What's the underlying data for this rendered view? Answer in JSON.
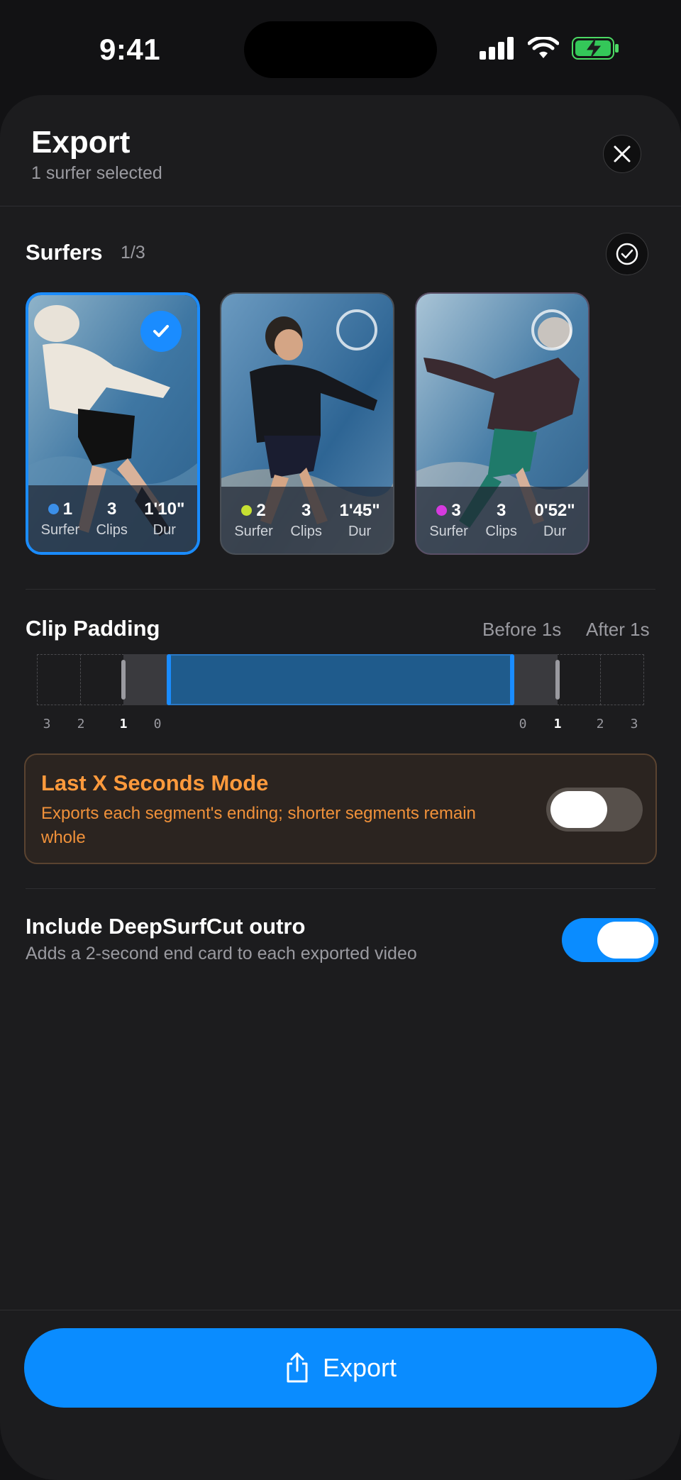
{
  "status_bar": {
    "time": "9:41"
  },
  "header": {
    "title": "Export",
    "subtitle": "1 surfer selected"
  },
  "surfers": {
    "title": "Surfers",
    "count": "1/3",
    "cards": [
      {
        "number": "1",
        "number_label": "Surfer",
        "clips": "3",
        "clips_label": "Clips",
        "duration": "1'10\"",
        "duration_label": "Dur",
        "dot_color": "#3b8fe8",
        "selected": true
      },
      {
        "number": "2",
        "number_label": "Surfer",
        "clips": "3",
        "clips_label": "Clips",
        "duration": "1'45\"",
        "duration_label": "Dur",
        "dot_color": "#c6e032",
        "selected": false
      },
      {
        "number": "3",
        "number_label": "Surfer",
        "clips": "3",
        "clips_label": "Clips",
        "duration": "0'52\"",
        "duration_label": "Dur",
        "dot_color": "#d63adf",
        "selected": false
      }
    ]
  },
  "clip_padding": {
    "title": "Clip Padding",
    "before": "Before 1s",
    "after": "After 1s",
    "ticks_left": [
      "3",
      "2",
      "1",
      "0"
    ],
    "ticks_right": [
      "0",
      "1",
      "2",
      "3"
    ]
  },
  "last_x_mode": {
    "title": "Last X Seconds Mode",
    "description": "Exports each segment's ending; shorter segments remain whole",
    "enabled": false
  },
  "outro": {
    "title": "Include DeepSurfCut outro",
    "description": "Adds a 2-second end card to each exported video",
    "enabled": true
  },
  "export_button": {
    "label": "Export"
  },
  "colors": {
    "accent": "#0a8cff",
    "warning": "#ff9a3c",
    "background": "#1c1c1e"
  }
}
